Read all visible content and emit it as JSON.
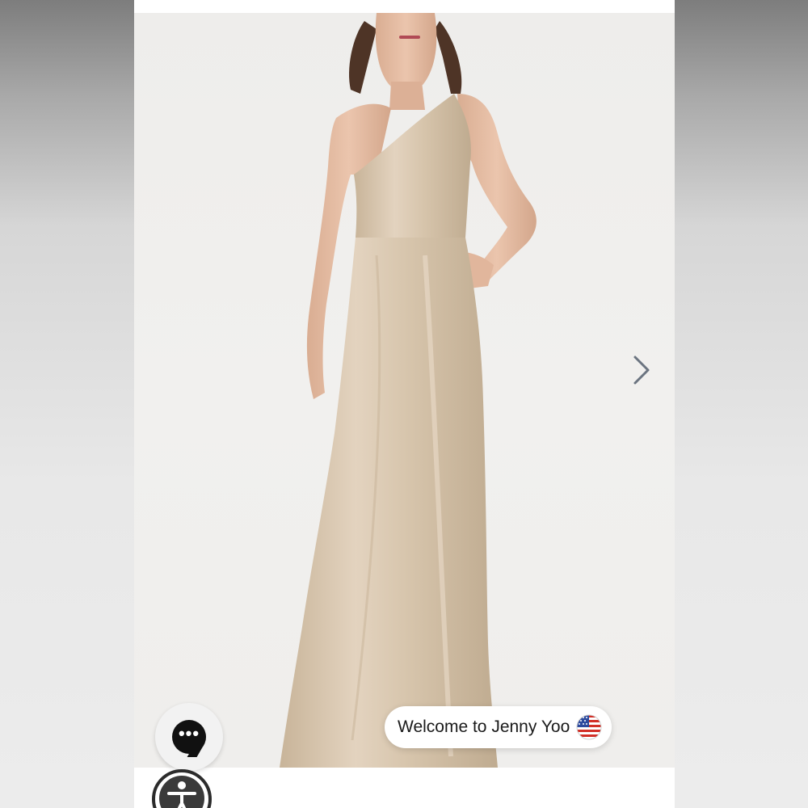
{
  "gallery": {
    "product_image": "one-shoulder satin gown photo",
    "next_icon": "chevron-right-icon"
  },
  "chat": {
    "icon": "chat-bubble-icon",
    "dots": "•••"
  },
  "welcome": {
    "text": "Welcome to Jenny Yoo",
    "flag": "us-flag-icon"
  },
  "accessibility": {
    "icon": "accessibility-icon"
  },
  "colors": {
    "backdrop": "#eeedeb",
    "dress": "#d6c4ab",
    "skin": "#e2b9a0",
    "hair": "#4e3426"
  }
}
